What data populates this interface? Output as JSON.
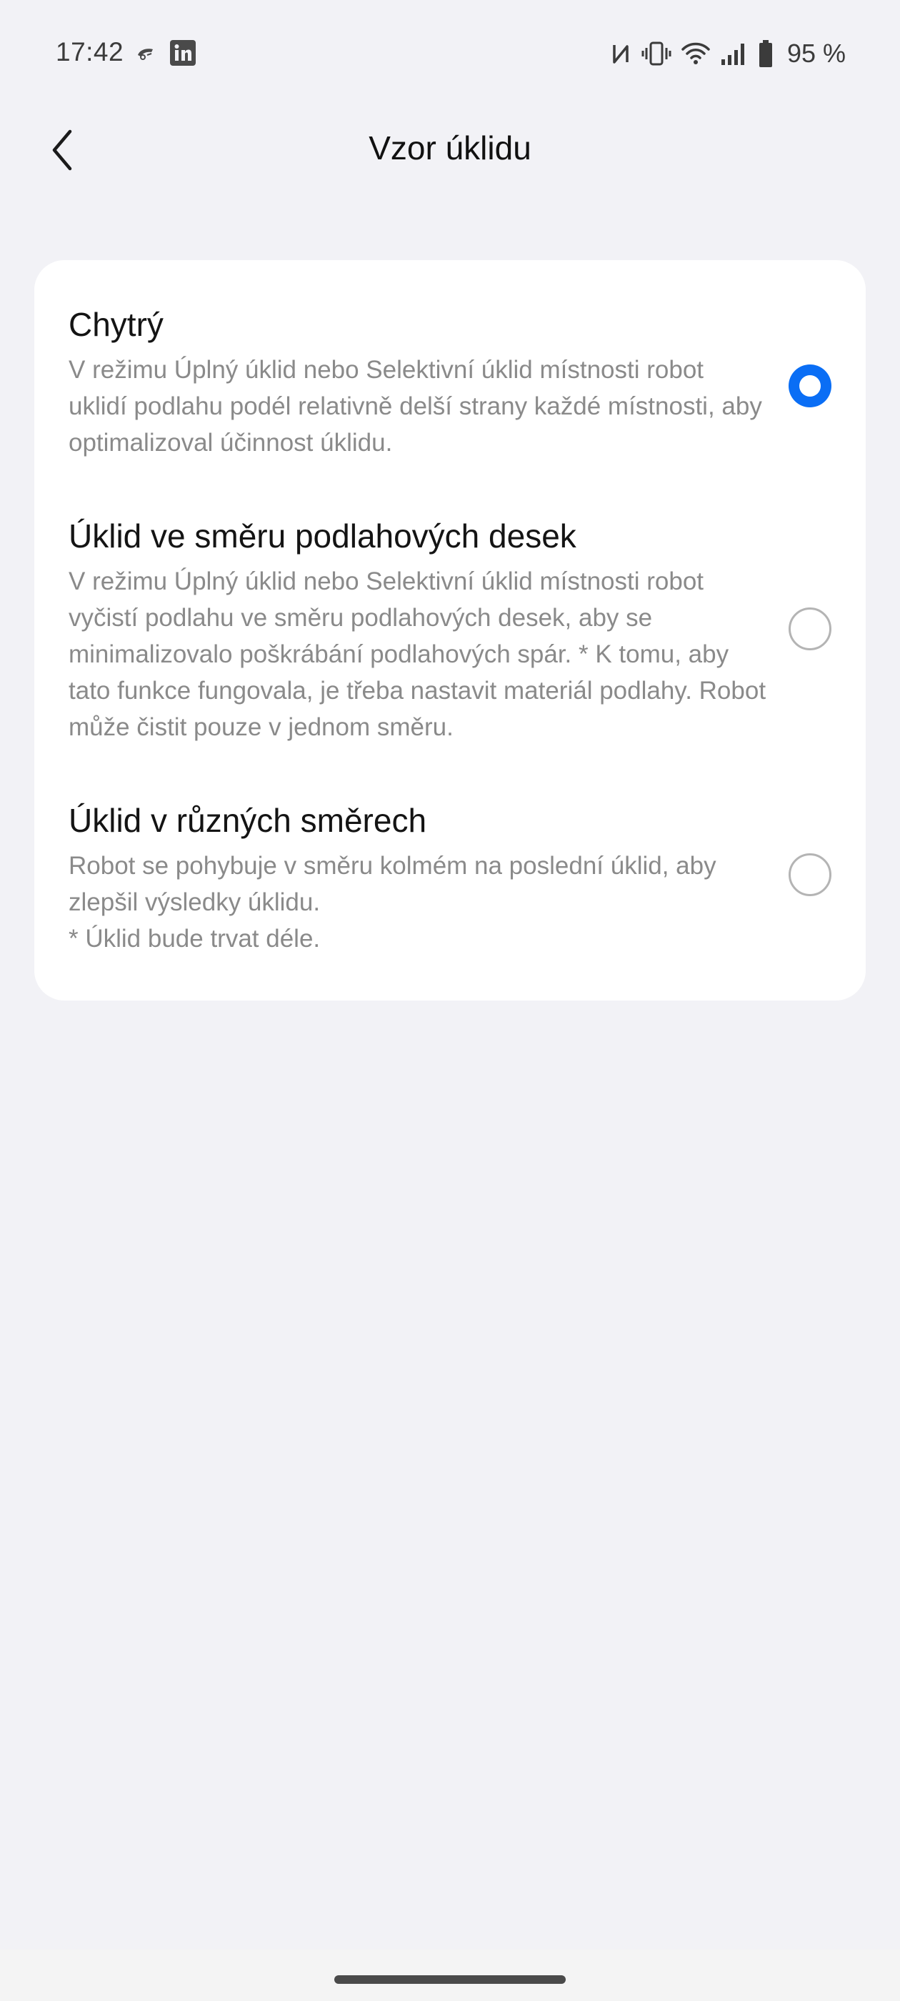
{
  "status_bar": {
    "time": "17:42",
    "battery": "95 %",
    "left_icons": [
      "robot-vacuum-icon",
      "linkedin-icon"
    ],
    "right_icons": [
      "nfc-icon",
      "vibrate-icon",
      "wifi-icon",
      "signal-icon",
      "battery-icon"
    ]
  },
  "header": {
    "title": "Vzor úklidu",
    "back_icon": "chevron-left-icon"
  },
  "options": [
    {
      "title": "Chytrý",
      "description": "V režimu Úplný úklid nebo Selektivní úklid místnosti robot uklidí podlahu podél relativně delší strany každé místnosti, aby optimalizoval účinnost úklidu.",
      "selected": true
    },
    {
      "title": "Úklid ve směru podlahových desek",
      "description": "V režimu Úplný úklid nebo Selektivní úklid místnosti robot vyčistí podlahu ve směru podlahových desek, aby se minimalizovalo poškrábání podlahových spár. * K tomu, aby tato funkce fungovala, je třeba nastavit materiál podlahy. Robot může čistit pouze v jednom směru.",
      "selected": false
    },
    {
      "title": "Úklid v různých směrech",
      "description_lines": [
        "Robot se pohybuje v směru kolmém na poslední úklid, aby zlepšil výsledky úklidu.",
        "* Úklid bude trvat déle."
      ],
      "selected": false
    }
  ],
  "colors": {
    "background": "#f2f2f6",
    "card": "#ffffff",
    "accent": "#0a6ef5",
    "secondary_text": "#8a8a8a"
  }
}
